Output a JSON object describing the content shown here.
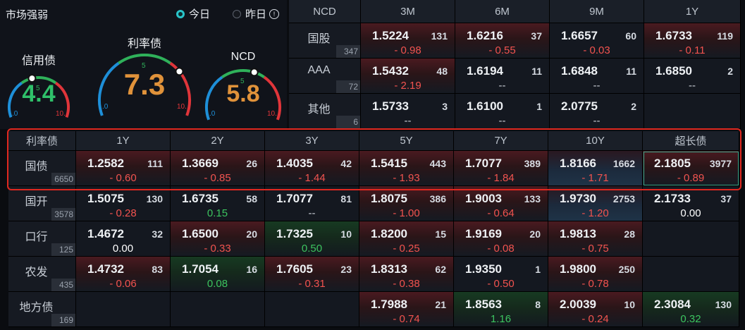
{
  "panel": {
    "title": "市场强弱",
    "radio_today": "今日",
    "radio_yesterday": "昨日",
    "info_icon": "info-circle-icon",
    "gauges": [
      {
        "title": "信用债",
        "value": "4.4",
        "level": 4.4,
        "color": "#2fc06a",
        "tick_min": ".0",
        "tick_mid": "5",
        "tick_max": "10."
      },
      {
        "title": "利率债",
        "value": "7.3",
        "level": 7.3,
        "color": "#e0923a",
        "tick_min": ".0",
        "tick_mid": "5",
        "tick_max": "10."
      },
      {
        "title": "NCD",
        "value": "5.8",
        "level": 5.8,
        "color": "#e0923a",
        "tick_min": ".0",
        "tick_mid": "5",
        "tick_max": "10."
      }
    ]
  },
  "top_table": {
    "corner": "NCD",
    "columns": [
      "3M",
      "6M",
      "9M",
      "1Y"
    ],
    "rows": [
      {
        "label": "国股",
        "count": "347",
        "cells": [
          {
            "price": "1.5224",
            "count": "131",
            "change": "- 0.98",
            "tone": "neg",
            "bg": "red"
          },
          {
            "price": "1.6216",
            "count": "37",
            "change": "- 0.55",
            "tone": "neg",
            "bg": "red"
          },
          {
            "price": "1.6657",
            "count": "60",
            "change": "- 0.03",
            "tone": "neg",
            "bg": "plain"
          },
          {
            "price": "1.6733",
            "count": "119",
            "change": "- 0.11",
            "tone": "neg",
            "bg": "red"
          }
        ]
      },
      {
        "label": "AAA",
        "count": "72",
        "cells": [
          {
            "price": "1.5432",
            "count": "48",
            "change": "- 2.19",
            "tone": "neg",
            "bg": "red"
          },
          {
            "price": "1.6194",
            "count": "11",
            "change": "--",
            "tone": "dash",
            "bg": "plain"
          },
          {
            "price": "1.6848",
            "count": "11",
            "change": "--",
            "tone": "dash",
            "bg": "plain"
          },
          {
            "price": "1.6850",
            "count": "2",
            "change": "--",
            "tone": "dash",
            "bg": "plain"
          }
        ]
      },
      {
        "label": "其他",
        "count": "6",
        "cells": [
          {
            "price": "1.5733",
            "count": "3",
            "change": "--",
            "tone": "dash",
            "bg": "plain"
          },
          {
            "price": "1.6100",
            "count": "1",
            "change": "--",
            "tone": "dash",
            "bg": "plain"
          },
          {
            "price": "2.0775",
            "count": "2",
            "change": "--",
            "tone": "dash",
            "bg": "plain"
          },
          {
            "price": "",
            "count": "",
            "change": "",
            "tone": "dash",
            "bg": "empty"
          }
        ]
      }
    ]
  },
  "bottom_table": {
    "corner": "利率债",
    "columns": [
      "1Y",
      "2Y",
      "3Y",
      "5Y",
      "7Y",
      "10Y",
      "超长债"
    ],
    "rows": [
      {
        "label": "国债",
        "count": "6650",
        "cells": [
          {
            "price": "1.2582",
            "count": "111",
            "change": "- 0.60",
            "tone": "neg",
            "bg": "red"
          },
          {
            "price": "1.3669",
            "count": "26",
            "change": "- 0.85",
            "tone": "neg",
            "bg": "red"
          },
          {
            "price": "1.4035",
            "count": "42",
            "change": "- 1.44",
            "tone": "neg",
            "bg": "red"
          },
          {
            "price": "1.5415",
            "count": "443",
            "change": "- 1.93",
            "tone": "neg",
            "bg": "red"
          },
          {
            "price": "1.7077",
            "count": "389",
            "change": "- 1.84",
            "tone": "neg",
            "bg": "red"
          },
          {
            "price": "1.8166",
            "count": "1662",
            "change": "- 1.71",
            "tone": "neg",
            "bg": "blue"
          },
          {
            "price": "2.1805",
            "count": "3977",
            "change": "- 0.89",
            "tone": "neg",
            "bg": "red",
            "selected": true
          }
        ]
      },
      {
        "label": "国开",
        "count": "3578",
        "cells": [
          {
            "price": "1.5075",
            "count": "130",
            "change": "- 0.28",
            "tone": "neg",
            "bg": "plain"
          },
          {
            "price": "1.6735",
            "count": "58",
            "change": "0.15",
            "tone": "pos",
            "bg": "plain"
          },
          {
            "price": "1.7077",
            "count": "81",
            "change": "--",
            "tone": "dash",
            "bg": "plain"
          },
          {
            "price": "1.8075",
            "count": "386",
            "change": "- 1.00",
            "tone": "neg",
            "bg": "red"
          },
          {
            "price": "1.9003",
            "count": "133",
            "change": "- 0.64",
            "tone": "neg",
            "bg": "red"
          },
          {
            "price": "1.9730",
            "count": "2753",
            "change": "- 1.20",
            "tone": "neg",
            "bg": "blue"
          },
          {
            "price": "2.1733",
            "count": "37",
            "change": "0.00",
            "tone": "neu",
            "bg": "plain"
          }
        ]
      },
      {
        "label": "口行",
        "count": "125",
        "cells": [
          {
            "price": "1.4672",
            "count": "32",
            "change": "0.00",
            "tone": "neu",
            "bg": "plain"
          },
          {
            "price": "1.6500",
            "count": "20",
            "change": "- 0.33",
            "tone": "neg",
            "bg": "red"
          },
          {
            "price": "1.7325",
            "count": "10",
            "change": "0.50",
            "tone": "pos",
            "bg": "green"
          },
          {
            "price": "1.8200",
            "count": "15",
            "change": "- 0.25",
            "tone": "neg",
            "bg": "red"
          },
          {
            "price": "1.9169",
            "count": "20",
            "change": "- 0.08",
            "tone": "neg",
            "bg": "red"
          },
          {
            "price": "1.9813",
            "count": "28",
            "change": "- 0.75",
            "tone": "neg",
            "bg": "red"
          },
          {
            "price": "",
            "count": "",
            "change": "",
            "tone": "dash",
            "bg": "empty"
          }
        ]
      },
      {
        "label": "农发",
        "count": "435",
        "cells": [
          {
            "price": "1.4732",
            "count": "83",
            "change": "- 0.06",
            "tone": "neg",
            "bg": "red"
          },
          {
            "price": "1.7054",
            "count": "16",
            "change": "0.08",
            "tone": "pos",
            "bg": "green"
          },
          {
            "price": "1.7605",
            "count": "23",
            "change": "- 0.31",
            "tone": "neg",
            "bg": "red"
          },
          {
            "price": "1.8313",
            "count": "62",
            "change": "- 0.38",
            "tone": "neg",
            "bg": "red"
          },
          {
            "price": "1.9350",
            "count": "1",
            "change": "- 0.50",
            "tone": "neg",
            "bg": "plain"
          },
          {
            "price": "1.9800",
            "count": "250",
            "change": "- 0.78",
            "tone": "neg",
            "bg": "red"
          },
          {
            "price": "",
            "count": "",
            "change": "",
            "tone": "dash",
            "bg": "empty"
          }
        ]
      },
      {
        "label": "地方债",
        "count": "169",
        "cells": [
          {
            "price": "",
            "count": "",
            "change": "",
            "tone": "dash",
            "bg": "empty"
          },
          {
            "price": "",
            "count": "",
            "change": "",
            "tone": "dash",
            "bg": "empty"
          },
          {
            "price": "",
            "count": "",
            "change": "",
            "tone": "dash",
            "bg": "empty"
          },
          {
            "price": "1.7988",
            "count": "21",
            "change": "- 0.74",
            "tone": "neg",
            "bg": "red"
          },
          {
            "price": "1.8563",
            "count": "8",
            "change": "1.16",
            "tone": "pos",
            "bg": "green"
          },
          {
            "price": "2.0039",
            "count": "10",
            "change": "- 0.24",
            "tone": "neg",
            "bg": "red"
          },
          {
            "price": "2.3084",
            "count": "130",
            "change": "0.32",
            "tone": "pos",
            "bg": "green"
          }
        ]
      }
    ]
  },
  "colors": {
    "negative": "#f2534f",
    "positive": "#3cc45f",
    "highlight_border": "#e0281f",
    "accent": "#29c4c9"
  }
}
